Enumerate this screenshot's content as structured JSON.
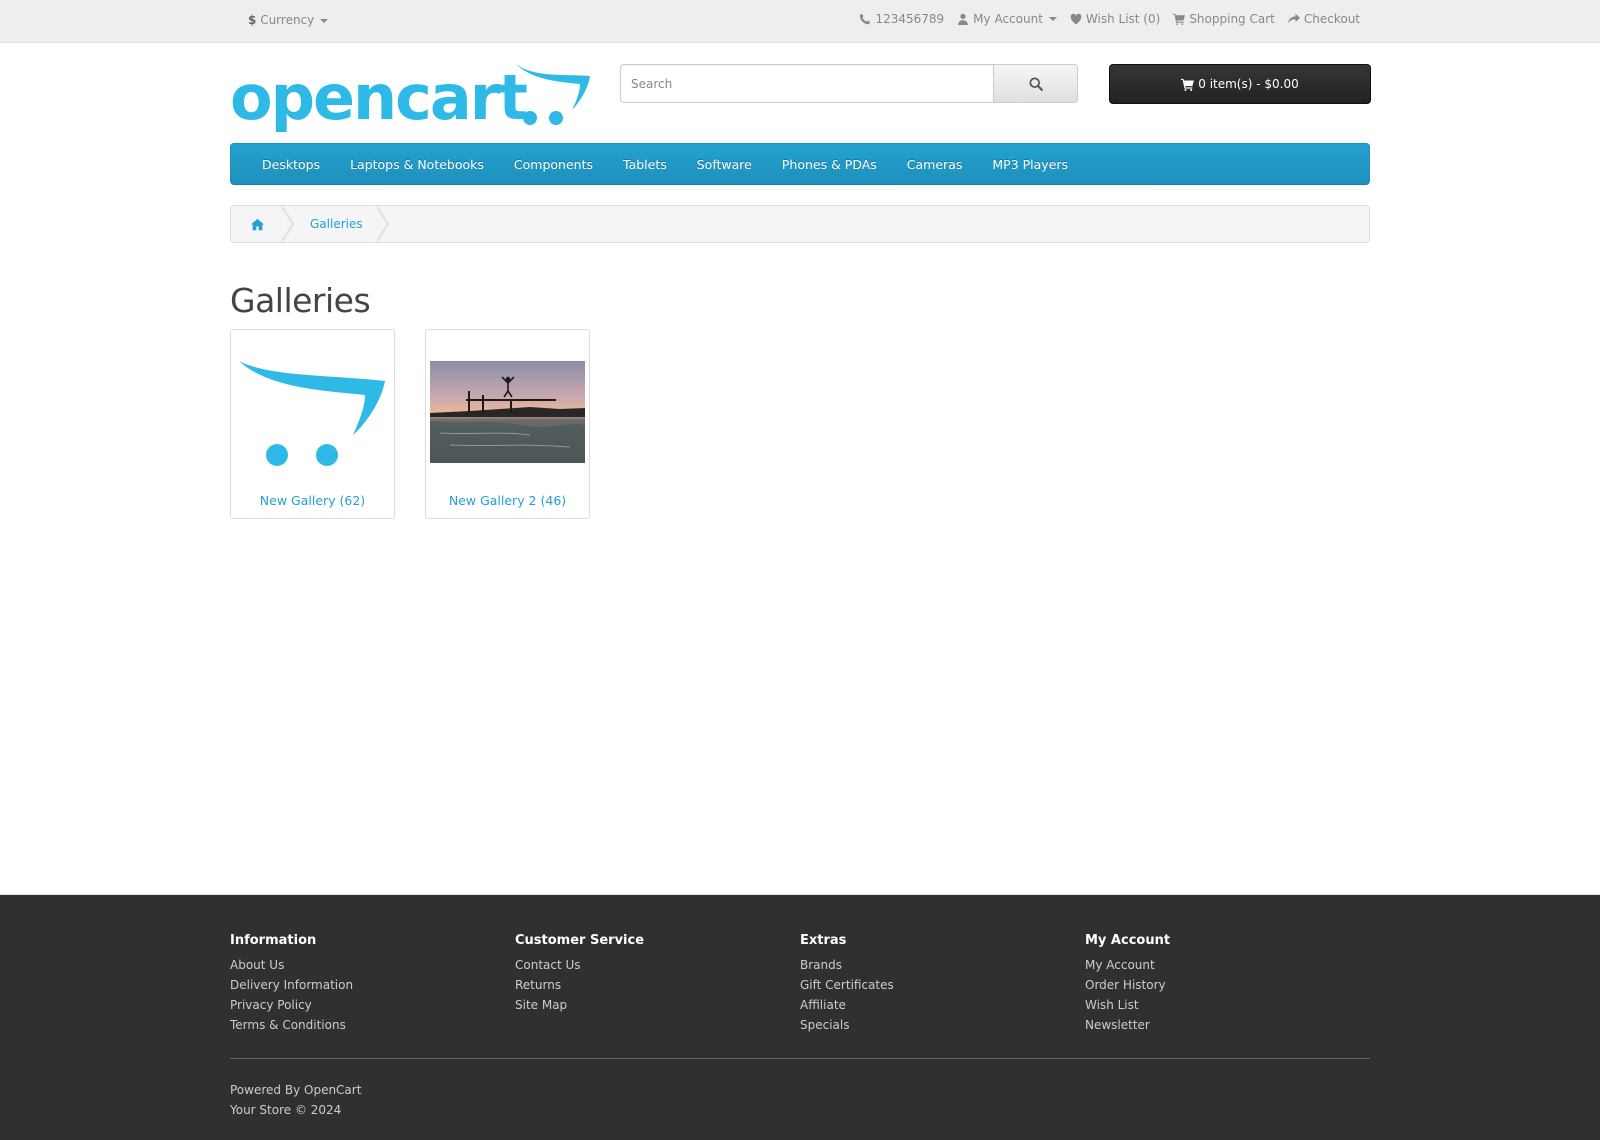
{
  "top": {
    "currency_symbol": "$",
    "currency_label": "Currency",
    "phone": "123456789",
    "my_account": "My Account",
    "wishlist": "Wish List (0)",
    "shopping_cart": "Shopping Cart",
    "checkout": "Checkout"
  },
  "header": {
    "logo_text": "opencart",
    "search_placeholder": "Search",
    "cart_label": "0 item(s) - $0.00"
  },
  "menu": {
    "items": [
      "Desktops",
      "Laptops & Notebooks",
      "Components",
      "Tablets",
      "Software",
      "Phones & PDAs",
      "Cameras",
      "MP3 Players"
    ]
  },
  "breadcrumb": {
    "current": "Galleries"
  },
  "page": {
    "title": "Galleries",
    "galleries": [
      {
        "name": "New Gallery (62)",
        "thumb": "opencart-cart-logo"
      },
      {
        "name": "New Gallery 2 (46)",
        "thumb": "sunset-pier-photo"
      }
    ]
  },
  "footer": {
    "columns": [
      {
        "title": "Information",
        "links": [
          "About Us",
          "Delivery Information",
          "Privacy Policy",
          "Terms & Conditions"
        ]
      },
      {
        "title": "Customer Service",
        "links": [
          "Contact Us",
          "Returns",
          "Site Map"
        ]
      },
      {
        "title": "Extras",
        "links": [
          "Brands",
          "Gift Certificates",
          "Affiliate",
          "Specials"
        ]
      },
      {
        "title": "My Account",
        "links": [
          "My Account",
          "Order History",
          "Wish List",
          "Newsletter"
        ]
      }
    ],
    "powered_prefix": "Powered By",
    "powered_link": "OpenCart",
    "copyright": "Your Store © 2024"
  },
  "colors": {
    "brand_blue": "#23a1d1",
    "logo_blue": "#2fb9e6",
    "footer_bg": "#303030"
  }
}
